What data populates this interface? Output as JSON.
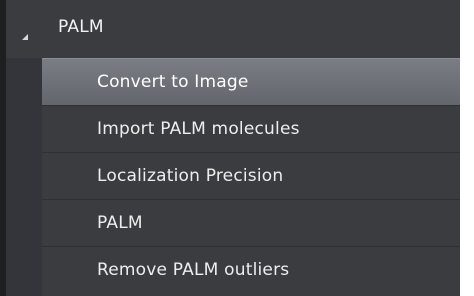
{
  "tree": {
    "group_label": "PALM",
    "expander_icon": "expanded-triangle-icon",
    "items": [
      {
        "label": "Convert to Image",
        "selected": true
      },
      {
        "label": "Import PALM molecules",
        "selected": false
      },
      {
        "label": "Localization Precision",
        "selected": false
      },
      {
        "label": "PALM",
        "selected": false
      },
      {
        "label": "Remove PALM outliers",
        "selected": false
      }
    ]
  },
  "colors": {
    "panel_bg": "#3a3c40",
    "selected_bg": "#6e7178",
    "text": "#eeeeee"
  }
}
